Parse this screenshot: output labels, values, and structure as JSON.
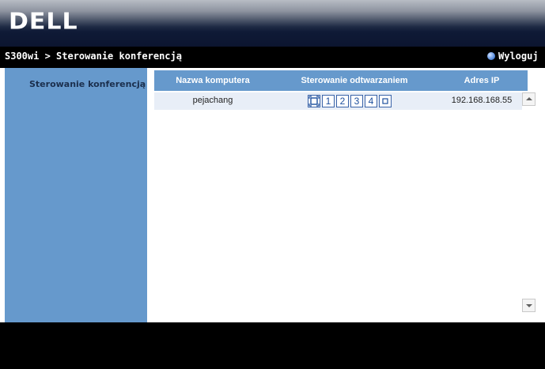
{
  "header": {
    "logo_text": "DELL"
  },
  "navbar": {
    "breadcrumb": "S300wi > Sterowanie konferencją",
    "logout_label": "Wyloguj",
    "logout_icon": "logout-globe-icon"
  },
  "sidebar": {
    "items": [
      {
        "label": "Sterowanie konferencją"
      }
    ]
  },
  "table": {
    "columns": [
      "Nazwa komputera",
      "Sterowanie odtwarzaniem",
      "Adres IP"
    ],
    "rows": [
      {
        "computer_name": "pejachang",
        "playback_controls": [
          "fullscreen-icon",
          "1",
          "2",
          "3",
          "4",
          "stop-icon"
        ],
        "ip_address": "192.168.168.55"
      }
    ]
  },
  "scrollbar": {
    "up_icon": "scroll-up-arrow-icon",
    "down_icon": "scroll-down-arrow-icon"
  },
  "colors": {
    "sidebar_blue": "#6699cc",
    "row_background": "#e8eef7",
    "control_border": "#3a63a8",
    "navbar_background": "#000000"
  }
}
